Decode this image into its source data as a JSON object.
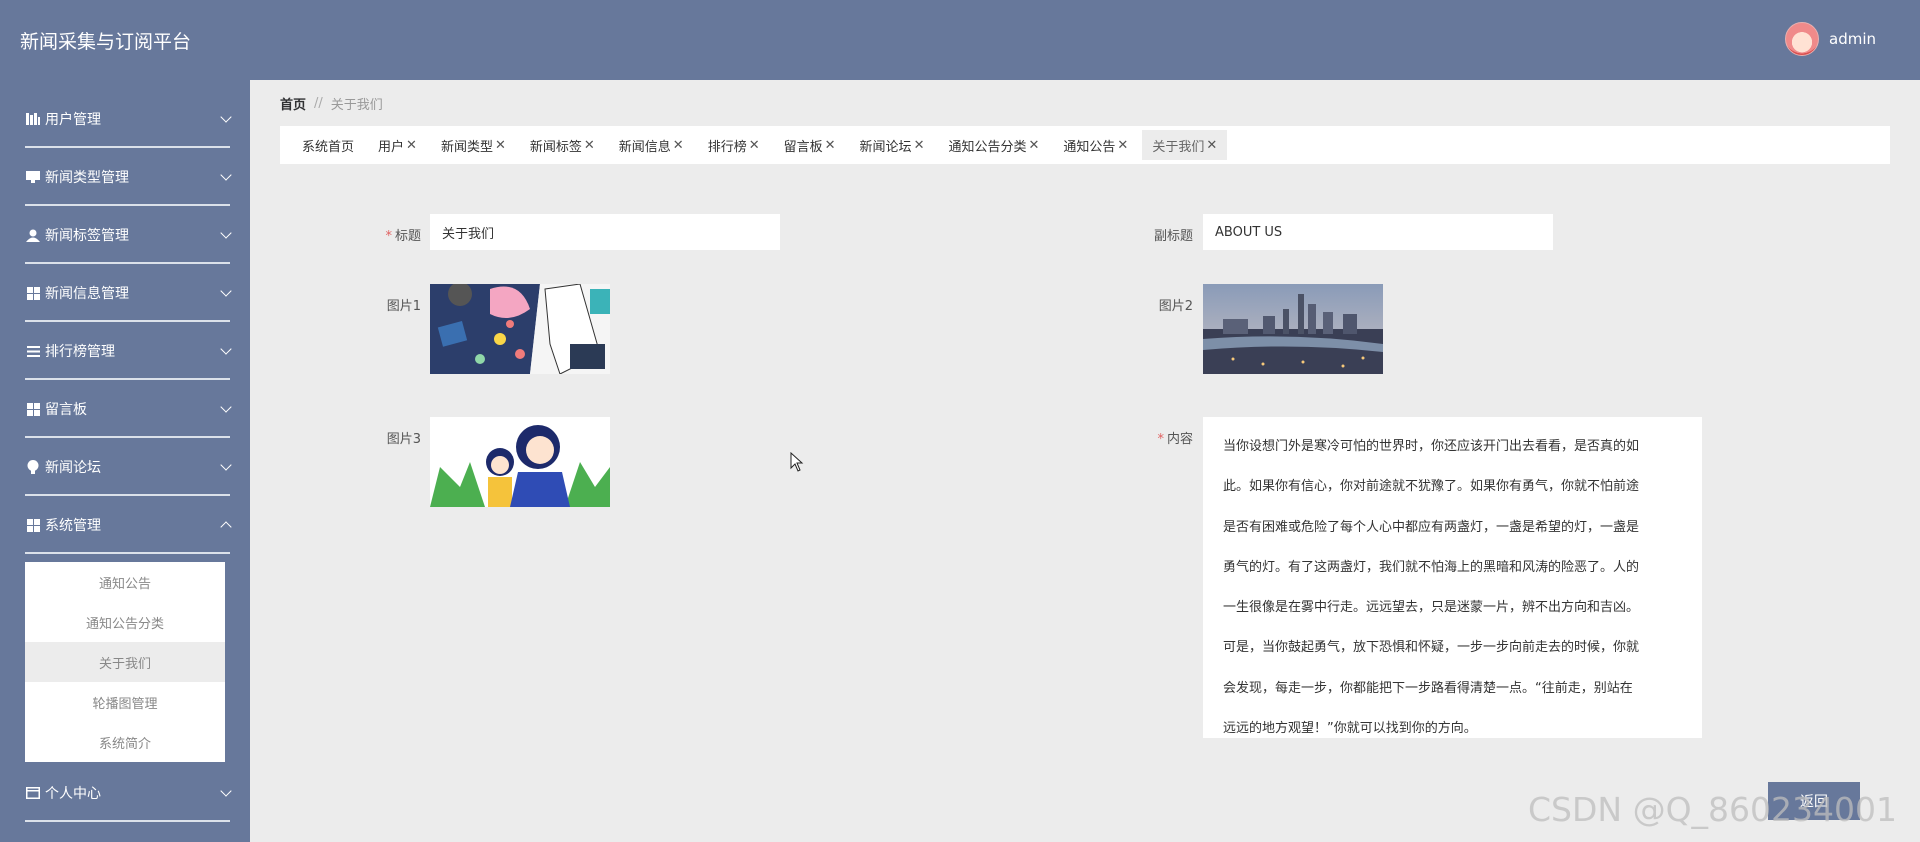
{
  "header": {
    "title": "新闻采集与订阅平台",
    "user": "admin"
  },
  "sidebar": {
    "items": [
      {
        "label": "用户管理",
        "icon": "bars-icon"
      },
      {
        "label": "新闻类型管理",
        "icon": "monitor-icon"
      },
      {
        "label": "新闻标签管理",
        "icon": "person-icon"
      },
      {
        "label": "新闻信息管理",
        "icon": "grid-icon"
      },
      {
        "label": "排行榜管理",
        "icon": "list-icon"
      },
      {
        "label": "留言板",
        "icon": "grid-icon"
      },
      {
        "label": "新闻论坛",
        "icon": "bulb-icon"
      },
      {
        "label": "系统管理",
        "icon": "grid-icon"
      },
      {
        "label": "个人中心",
        "icon": "card-icon"
      }
    ],
    "submenu": [
      "通知公告",
      "通知公告分类",
      "关于我们",
      "轮播图管理",
      "系统简介"
    ]
  },
  "breadcrumb": {
    "home": "首页",
    "sep": "//",
    "current": "关于我们"
  },
  "tabs": [
    {
      "label": "系统首页",
      "closable": false
    },
    {
      "label": "用户",
      "closable": true
    },
    {
      "label": "新闻类型",
      "closable": true
    },
    {
      "label": "新闻标签",
      "closable": true
    },
    {
      "label": "新闻信息",
      "closable": true
    },
    {
      "label": "排行榜",
      "closable": true
    },
    {
      "label": "留言板",
      "closable": true
    },
    {
      "label": "新闻论坛",
      "closable": true
    },
    {
      "label": "通知公告分类",
      "closable": true
    },
    {
      "label": "通知公告",
      "closable": true
    },
    {
      "label": "关于我们",
      "closable": true
    }
  ],
  "form": {
    "title_label": "标题",
    "title_value": "关于我们",
    "subtitle_label": "副标题",
    "subtitle_value": "ABOUT US",
    "pic1_label": "图片1",
    "pic2_label": "图片2",
    "pic3_label": "图片3",
    "content_label": "内容",
    "content_lines": [
      "当你设想门外是寒冷可怕的世界时，你还应该开门出去看看，是否真的如",
      "此。如果你有信心，你对前途就不犹豫了。如果你有勇气，你就不怕前途",
      "是否有困难或危险了每个人心中都应有两盏灯，一盏是希望的灯，一盏是",
      "勇气的灯。有了这两盏灯，我们就不怕海上的黑暗和风涛的险恶了。人的",
      "一生很像是在雾中行走。远远望去，只是迷蒙一片，辨不出方向和吉凶。",
      "可是，当你鼓起勇气，放下恐惧和怀疑，一步一步向前走去的时候，你就",
      "会发现，每走一步，你都能把下一步路看得清楚一点。“往前走，别站在",
      "远远的地方观望！”你就可以找到你的方向。"
    ]
  },
  "back_button": "返回",
  "watermark": "CSDN @Q_860234001",
  "colors": {
    "primary": "#67789b",
    "background": "#ececec",
    "required": "#e06060"
  }
}
